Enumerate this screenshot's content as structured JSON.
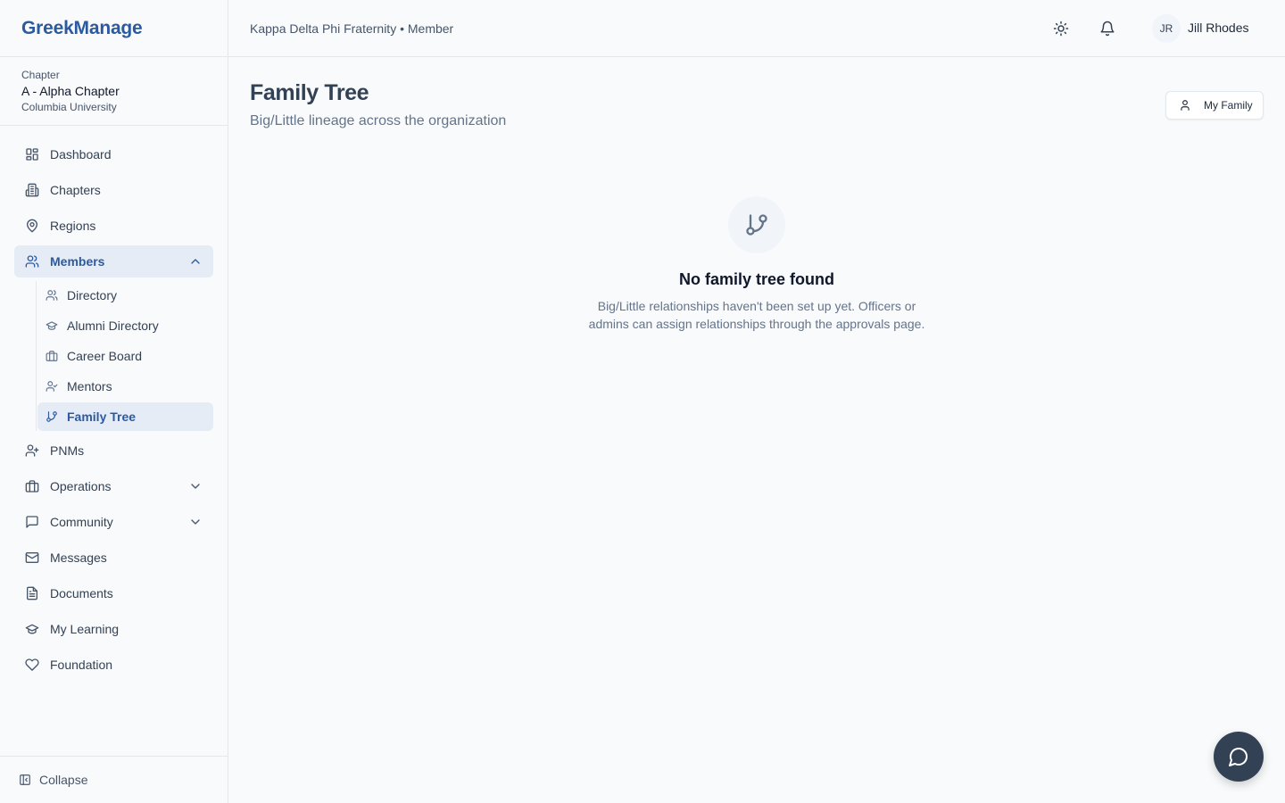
{
  "brand": {
    "name": "GreekManage"
  },
  "chapter": {
    "label": "Chapter",
    "name": "A - Alpha Chapter",
    "university": "Columbia University"
  },
  "sidebar": {
    "items": [
      {
        "label": "Dashboard",
        "icon": "dashboard-icon"
      },
      {
        "label": "Chapters",
        "icon": "building-icon"
      },
      {
        "label": "Regions",
        "icon": "map-pin-icon"
      },
      {
        "label": "Members",
        "icon": "users-icon",
        "expanded": true
      },
      {
        "label": "PNMs",
        "icon": "user-plus-icon"
      },
      {
        "label": "Operations",
        "icon": "briefcase-icon"
      },
      {
        "label": "Community",
        "icon": "message-square-icon"
      },
      {
        "label": "Messages",
        "icon": "mail-icon"
      },
      {
        "label": "Documents",
        "icon": "file-text-icon"
      },
      {
        "label": "My Learning",
        "icon": "graduation-cap-icon"
      },
      {
        "label": "Foundation",
        "icon": "heart-icon"
      }
    ],
    "members_sub": [
      {
        "label": "Directory",
        "icon": "users-icon"
      },
      {
        "label": "Alumni Directory",
        "icon": "graduation-cap-icon"
      },
      {
        "label": "Career Board",
        "icon": "briefcase-icon"
      },
      {
        "label": "Mentors",
        "icon": "user-check-icon"
      },
      {
        "label": "Family Tree",
        "icon": "git-branch-icon",
        "active": true
      }
    ],
    "collapse_label": "Collapse"
  },
  "header": {
    "org_line": "Kappa Delta Phi Fraternity • Member",
    "user_initials": "JR",
    "user_name": "Jill Rhodes"
  },
  "main": {
    "title": "Family Tree",
    "subtitle": "Big/Little lineage across the organization",
    "my_family_label": "My Family",
    "empty_title": "No family tree found",
    "empty_text": "Big/Little relationships haven't been set up yet. Officers or admins can assign relationships through the approvals page."
  },
  "colors": {
    "brand": "#2c5aa0",
    "active_bg": "#e6ecf5",
    "fab": "#334155"
  }
}
